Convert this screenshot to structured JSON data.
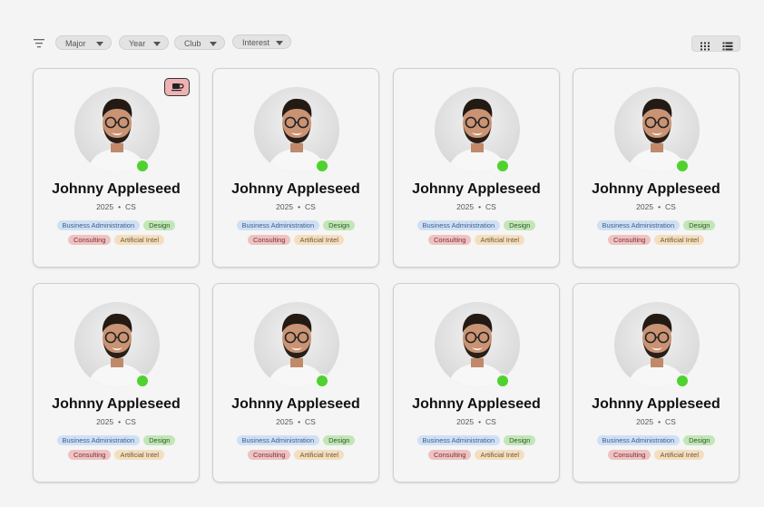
{
  "filters": [
    "Major",
    "Year",
    "Club",
    "Interest"
  ],
  "view_toggle": {
    "grid_icon": "grid-view-icon",
    "list_icon": "list-view-icon"
  },
  "colors": {
    "online": "#4fd22f",
    "coffee_badge": "#efb2b2"
  },
  "cards": [
    {
      "name": "Johnny Appleseed",
      "year": "2025",
      "major": "CS",
      "show_dot": true,
      "coffee": true,
      "tags": [
        "Business Administration",
        "Design",
        "Consulting",
        "Artificial Intel"
      ]
    },
    {
      "name": "Johnny Appleseed",
      "year": "2025",
      "major": "CS",
      "show_dot": false,
      "coffee": false,
      "tags": [
        "Business Administration",
        "Design",
        "Consulting",
        "Artificial Intel"
      ]
    },
    {
      "name": "Johnny Appleseed",
      "year": "2025",
      "major": "CS",
      "show_dot": false,
      "coffee": false,
      "tags": [
        "Business Administration",
        "Design",
        "Consulting",
        "Artificial Intel"
      ]
    },
    {
      "name": "Johnny Appleseed",
      "year": "2025",
      "major": "CS",
      "show_dot": false,
      "coffee": false,
      "tags": [
        "Business Administration",
        "Design",
        "Consulting",
        "Artificial Intel"
      ]
    },
    {
      "name": "Johnny Appleseed",
      "year": "2025",
      "major": "CS",
      "show_dot": true,
      "coffee": false,
      "tags": [
        "Business Administration",
        "Design",
        "Consulting",
        "Artificial Intel"
      ]
    },
    {
      "name": "Johnny Appleseed",
      "year": "2025",
      "major": "CS",
      "show_dot": false,
      "coffee": false,
      "tags": [
        "Business Administration",
        "Design",
        "Consulting",
        "Artificial Intel"
      ]
    },
    {
      "name": "Johnny Appleseed",
      "year": "2025",
      "major": "CS",
      "show_dot": false,
      "coffee": false,
      "tags": [
        "Business Administration",
        "Design",
        "Consulting",
        "Artificial Intel"
      ]
    },
    {
      "name": "Johnny Appleseed",
      "year": "2025",
      "major": "CS",
      "show_dot": false,
      "coffee": false,
      "tags": [
        "Business Administration",
        "Design",
        "Consulting",
        "Artificial Intel"
      ]
    }
  ]
}
